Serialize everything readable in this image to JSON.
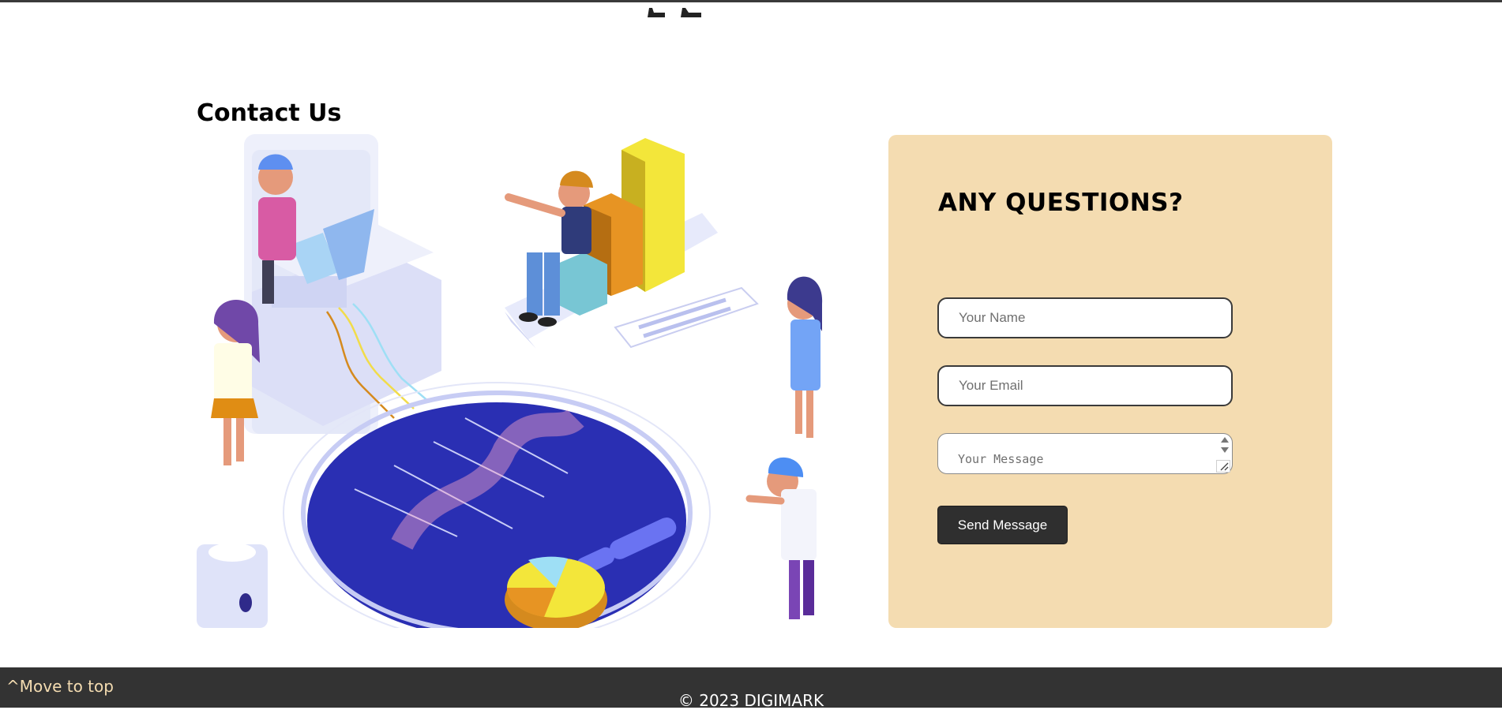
{
  "contact": {
    "heading": "Contact Us"
  },
  "form": {
    "title": "ANY QUESTIONS?",
    "name_placeholder": "Your Name",
    "email_placeholder": "Your Email",
    "message_placeholder": "Your Message",
    "send_label": "Send Message"
  },
  "footer": {
    "move_top_label": "^Move to top",
    "copyright": "© 2023 DIGIMARK"
  },
  "colors": {
    "card_background": "#f4dcb1",
    "footer_background": "#333333",
    "button_background": "#2f2f2f",
    "move_top_link": "#f4dcb1"
  },
  "icons": [
    "spinner-arrows-icon",
    "resize-grip-icon"
  ]
}
